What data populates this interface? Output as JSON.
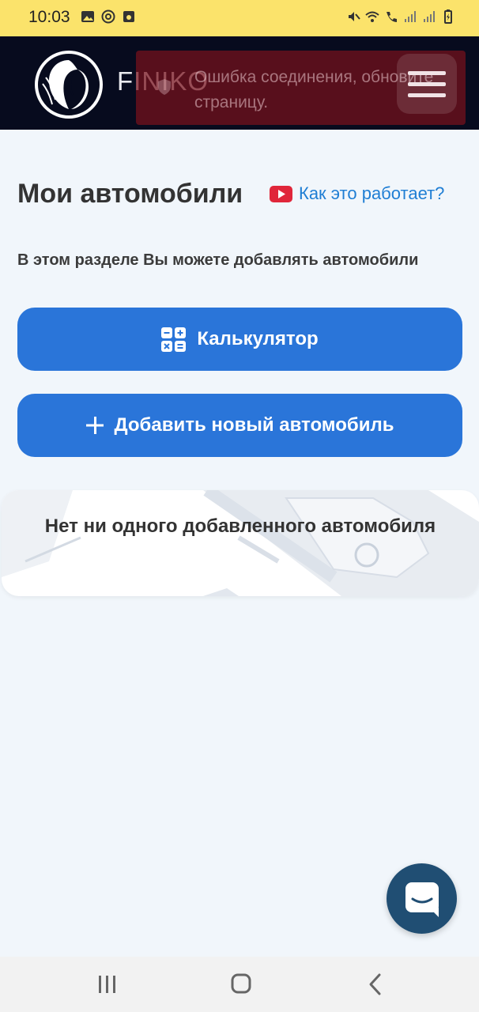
{
  "status_bar": {
    "time": "10:03",
    "left_icons": [
      "image-icon",
      "at-icon",
      "app-icon"
    ],
    "right_icons": [
      "mute-icon",
      "wifi-icon",
      "call-icon",
      "signal-icon",
      "signal-icon",
      "battery-icon"
    ]
  },
  "header": {
    "brand": "FINIKO",
    "error_toast": "Ошибка соединения, обновите страницу.",
    "menu_icon": "hamburger-icon"
  },
  "page": {
    "title": "Мои автомобили",
    "how_it_works": "Как это работает?",
    "subtitle": "В этом разделе Вы можете добавлять автомобили"
  },
  "buttons": {
    "calculator": "Калькулятор",
    "add_car": "Добавить новый автомобиль"
  },
  "empty_state": {
    "message": "Нет ни одного добавленного автомобиля"
  },
  "colors": {
    "status_bar": "#fbe36b",
    "header": "#070b1e",
    "primary_button": "#2a75d9",
    "link": "#1f7ed4",
    "chat_button": "#204e73",
    "error_toast": "#78101c"
  }
}
